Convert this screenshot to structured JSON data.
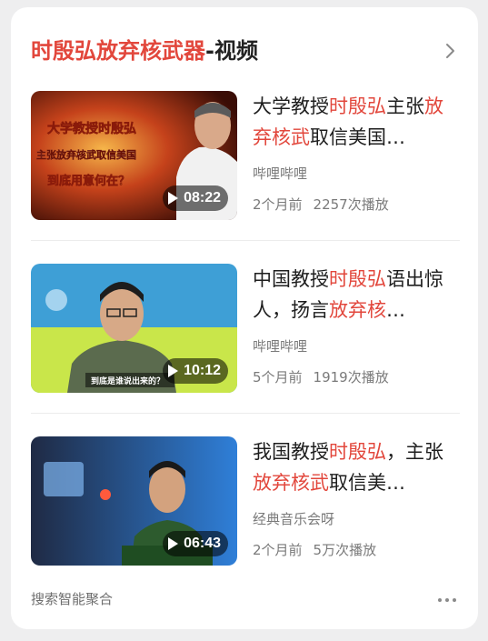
{
  "header": {
    "title_highlight": "时殷弘放弃核武器",
    "title_suffix": "-视频"
  },
  "videos": [
    {
      "title_parts": [
        "大学教授",
        "时殷弘",
        "主张",
        "放弃核武",
        "取信美国…"
      ],
      "uploader": "哔哩哔哩",
      "time_ago": "2个月前",
      "plays": "2257次播放",
      "duration": "08:22",
      "thumb_caption": [
        "大学教授时殷弘",
        "主张放弃核武取信美国",
        "到底用意何在？"
      ]
    },
    {
      "title_parts": [
        "中国教授",
        "时殷弘",
        "语出惊人，扬言",
        "放弃核",
        "…"
      ],
      "uploader": "哔哩哔哩",
      "time_ago": "5个月前",
      "plays": "1919次播放",
      "duration": "10:12",
      "thumb_caption": [
        "到底是谁说出来的？"
      ]
    },
    {
      "title_parts": [
        "我国教授",
        "时殷弘",
        "，主张",
        "放弃核武",
        "取信美…"
      ],
      "uploader": "经典音乐会呀",
      "time_ago": "2个月前",
      "plays": "5万次播放",
      "duration": "06:43",
      "thumb_caption": []
    }
  ],
  "footer": {
    "label": "搜索智能聚合"
  },
  "colors": {
    "highlight": "#e2473c",
    "text": "#1e1e1e",
    "meta": "#7a7a7a"
  },
  "icons": [
    "chevron-right-icon",
    "play-icon",
    "more-icon"
  ]
}
